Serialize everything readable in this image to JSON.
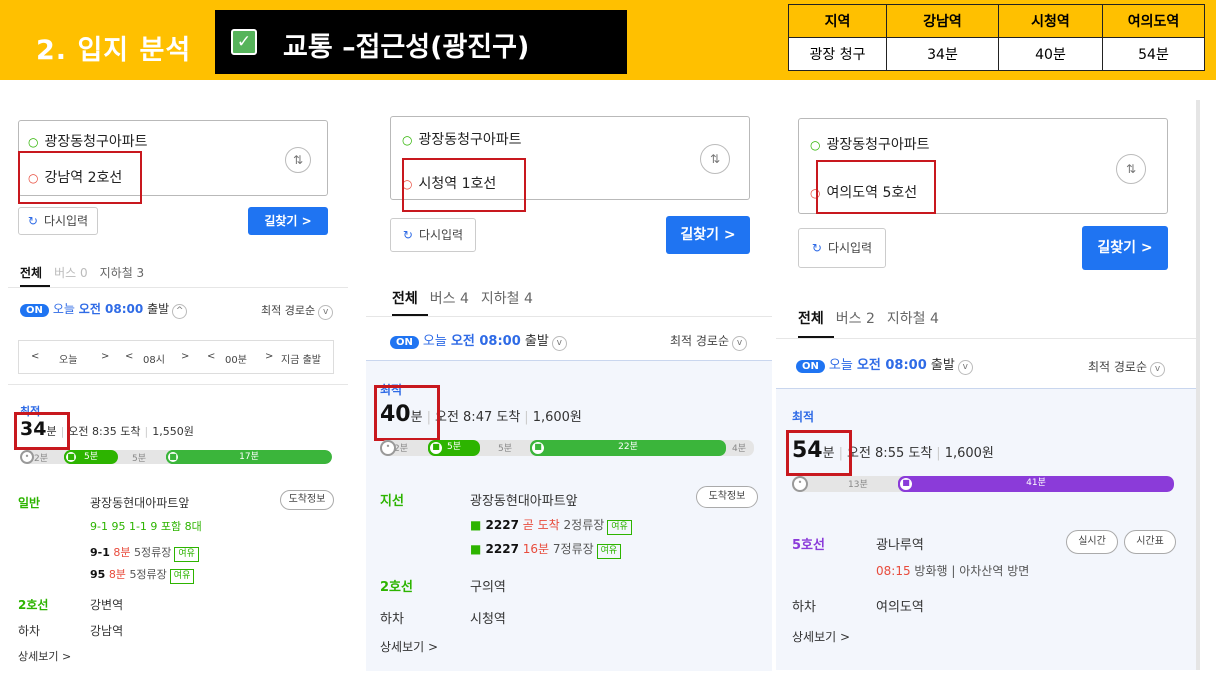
{
  "header": {
    "title": "2. 입지 분석",
    "subtitle": "교통 –접근성(광진구)",
    "check_icon": "check-icon",
    "accent": "#FFC000"
  },
  "summary_table": {
    "columns": [
      "지역",
      "강남역",
      "시청역",
      "여의도역"
    ],
    "rows": [
      [
        "광장 청구",
        "34분",
        "40분",
        "54분"
      ]
    ]
  },
  "panels": [
    {
      "origin": "광장동청구아파트",
      "destination": "강남역 2호선",
      "reset": "다시입력",
      "search": "길찾기 >",
      "tabs": {
        "all": "전체",
        "bus": "버스 0",
        "subway": "지하철 3"
      },
      "departure": {
        "on": "ON",
        "prefix": "오늘",
        "time": "오전 08:00",
        "suffix": "출발"
      },
      "sort": "최적 경로순",
      "time_controls": [
        "<",
        "오늘",
        ">",
        "<",
        "08시",
        ">",
        "<",
        "00분",
        ">",
        "지금 출발"
      ],
      "best": "최적",
      "minutes": "34",
      "min_unit": "분",
      "arrival": "오전 8:35 도착",
      "fare": "1,550원",
      "segments": {
        "walk1": "2분",
        "bus": "5분",
        "walk2": "5분",
        "subway": "17분"
      },
      "steps": {
        "type1": "일반",
        "stop1": "광장동현대아파트앞",
        "btn1": "도착정보",
        "routes": "9-1  95  1-1  9  포함 8대",
        "bus1_no": "9-1",
        "bus1_time": "8분",
        "bus1_stops": "5정류장",
        "bus1_tag": "여유",
        "bus2_no": "95",
        "bus2_time": "8분",
        "bus2_stops": "5정류장",
        "bus2_tag": "여유",
        "type2": "2호선",
        "stop2": "강변역",
        "type3": "하차",
        "stop3": "강남역"
      },
      "more": "상세보기 >"
    },
    {
      "origin": "광장동청구아파트",
      "destination": "시청역 1호선",
      "reset": "다시입력",
      "search": "길찾기 >",
      "tabs": {
        "all": "전체",
        "bus": "버스 4",
        "subway": "지하철 4"
      },
      "departure": {
        "on": "ON",
        "prefix": "오늘",
        "time": "오전 08:00",
        "suffix": "출발"
      },
      "sort": "최적 경로순",
      "best": "최적",
      "minutes": "40",
      "min_unit": "분",
      "arrival": "오전 8:47 도착",
      "fare": "1,600원",
      "segments": {
        "walk1": "2분",
        "bus": "5분",
        "walk2": "5분",
        "subway": "22분",
        "walk3": "4분"
      },
      "steps": {
        "type1": "지선",
        "stop1": "광장동현대아파트앞",
        "btn1": "도착정보",
        "bus1_no": "2227",
        "bus1_time": "곧 도착",
        "bus1_stops": "2정류장",
        "bus1_tag": "여유",
        "bus2_no": "2227",
        "bus2_time": "16분",
        "bus2_stops": "7정류장",
        "bus2_tag": "여유",
        "type2": "2호선",
        "stop2": "구의역",
        "type3": "하차",
        "stop3": "시청역"
      },
      "more": "상세보기 >"
    },
    {
      "origin": "광장동청구아파트",
      "destination": "여의도역 5호선",
      "reset": "다시입력",
      "search": "길찾기 >",
      "tabs": {
        "all": "전체",
        "bus": "버스 2",
        "subway": "지하철 4"
      },
      "departure": {
        "on": "ON",
        "prefix": "오늘",
        "time": "오전 08:00",
        "suffix": "출발"
      },
      "sort": "최적 경로순",
      "best": "최적",
      "minutes": "54",
      "min_unit": "분",
      "arrival": "오전 8:55 도착",
      "fare": "1,600원",
      "segments": {
        "walk1": "13분",
        "subway": "41분"
      },
      "steps": {
        "type1": "5호선",
        "stop1": "광나루역",
        "btn1": "실시간",
        "btn2": "시간표",
        "train_time": "08:15",
        "train_dir": "방화행 | 아차산역 방면",
        "type3": "하차",
        "stop3": "여의도역"
      },
      "more": "상세보기 >"
    }
  ]
}
